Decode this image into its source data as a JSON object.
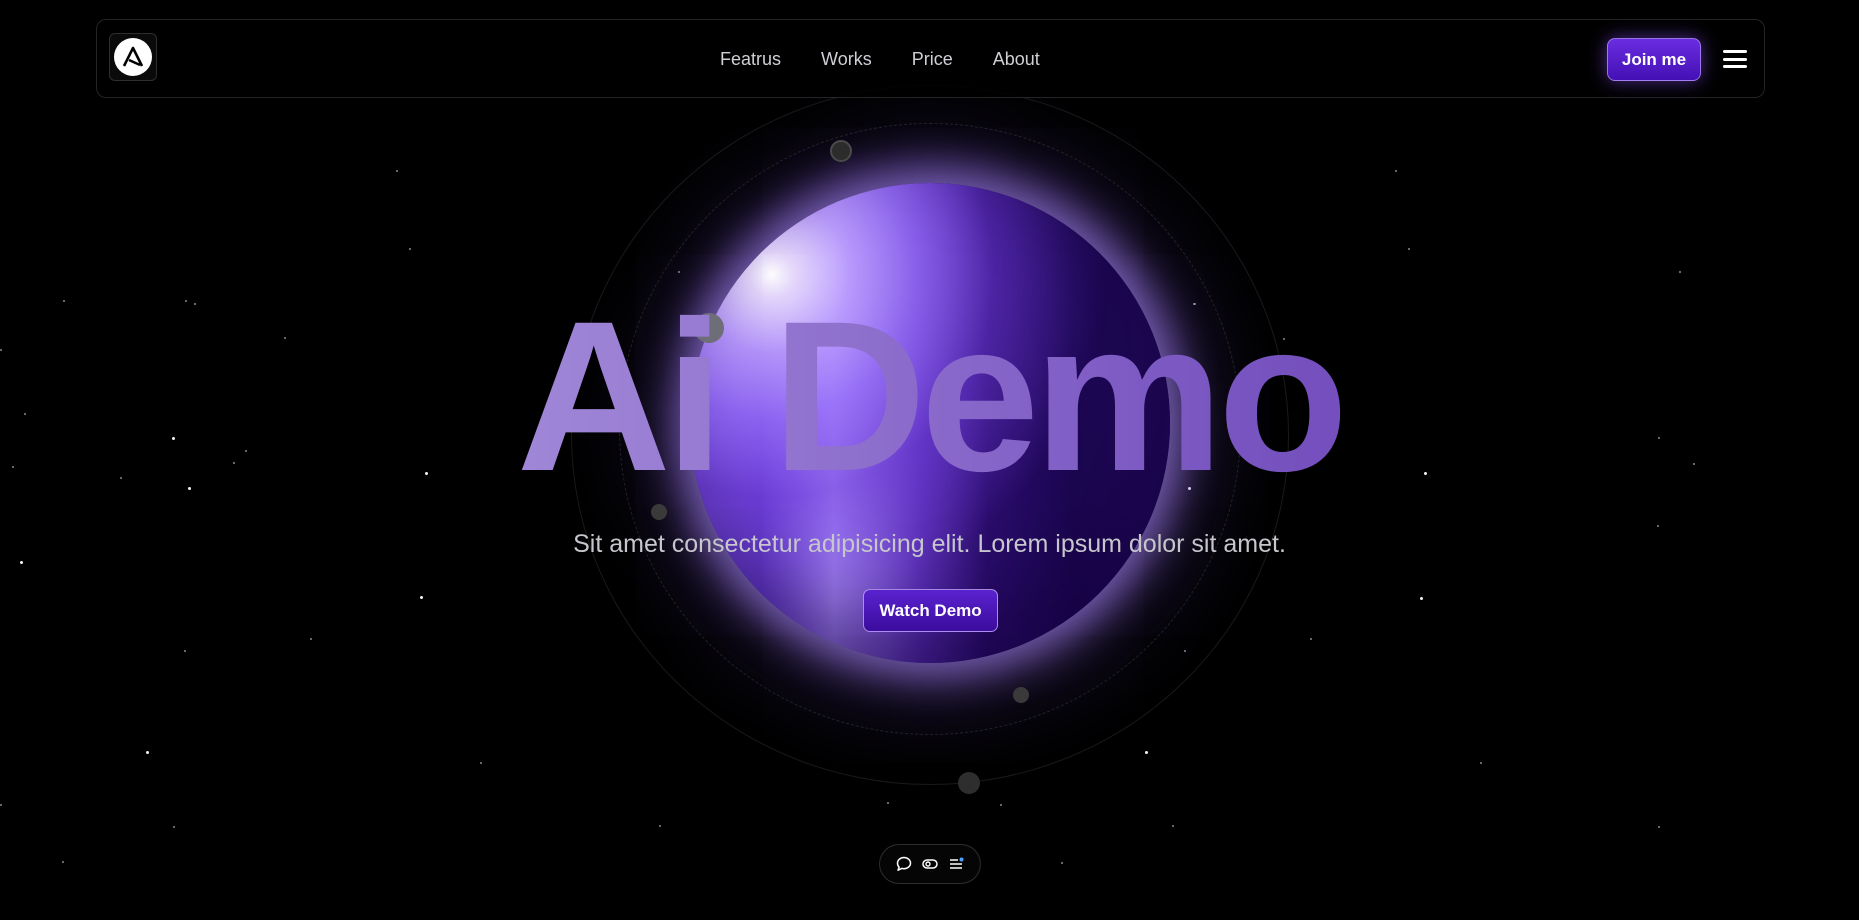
{
  "nav": {
    "logo_icon": "a-logo-icon",
    "links": [
      "Featrus",
      "Works",
      "Price",
      "About"
    ],
    "join_label": "Join me",
    "menu_icon": "hamburger-menu-icon"
  },
  "hero": {
    "title": "Ai Demo",
    "subtitle": "Sit amet consectetur adipisicing elit. Lorem ipsum dolor sit amet.",
    "cta_label": "Watch Demo"
  },
  "dock": {
    "icons": [
      "chat-bubble-icon",
      "toggle-icon",
      "list-settings-icon"
    ]
  },
  "colors": {
    "accent": "#5a22cf",
    "background": "#000000",
    "sphere": "#2a0c6b"
  }
}
